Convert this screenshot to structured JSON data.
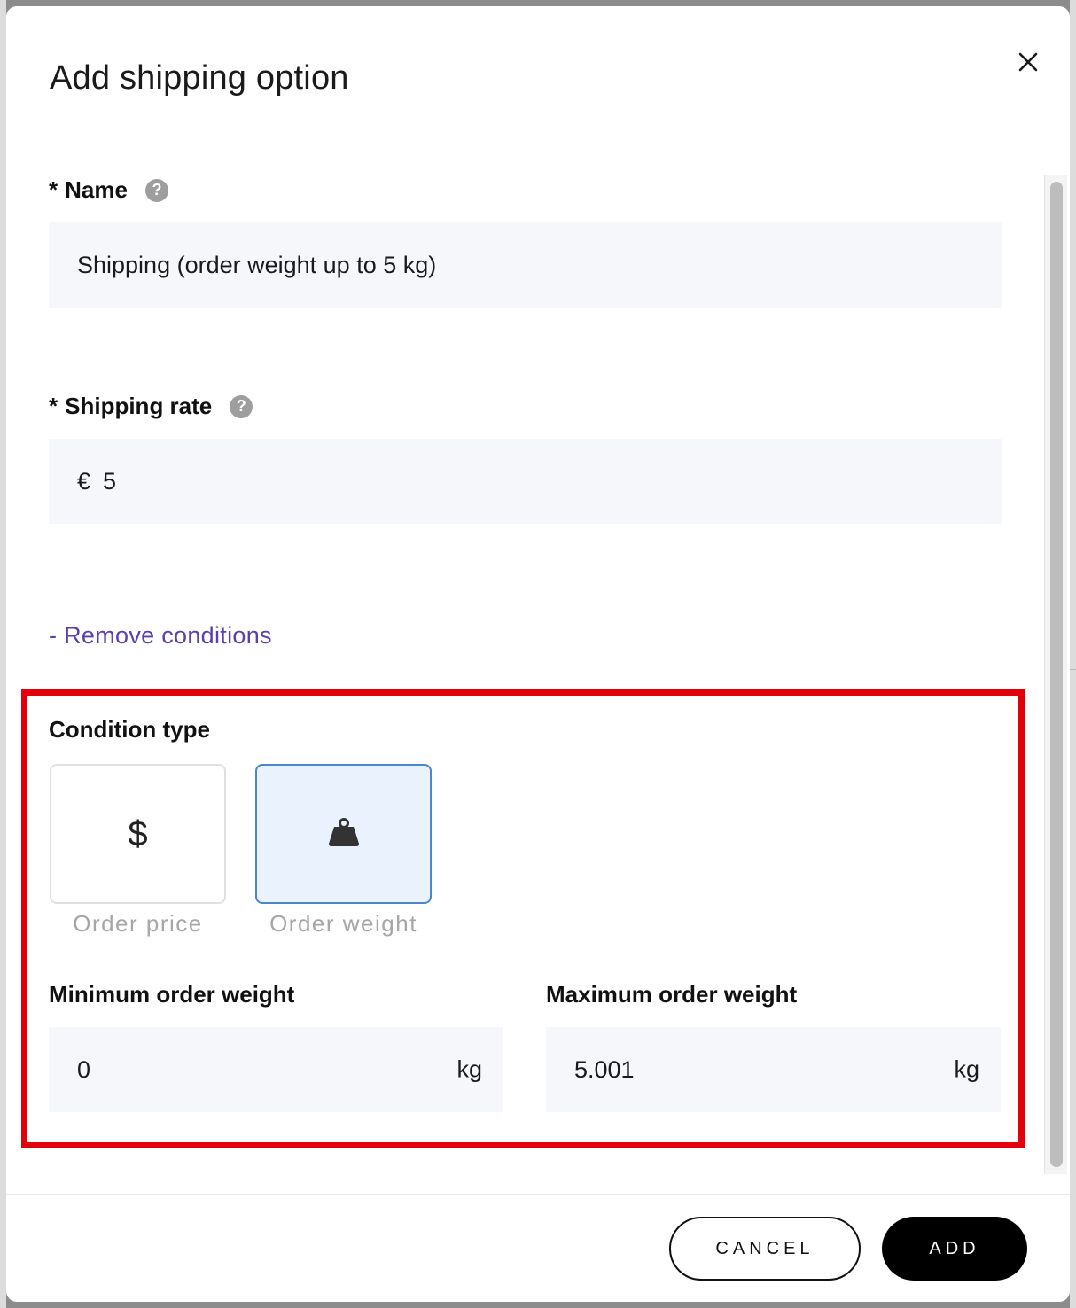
{
  "modal": {
    "title": "Add shipping option"
  },
  "name_field": {
    "required_marker": "*",
    "label": "Name",
    "help": "?",
    "value": "Shipping (order weight up to 5 kg)"
  },
  "rate_field": {
    "required_marker": "*",
    "label": "Shipping rate",
    "help": "?",
    "currency": "€",
    "value": "5"
  },
  "conditions": {
    "remove_link": "- Remove conditions",
    "section_title": "Condition type",
    "types": [
      {
        "label": "Order price",
        "icon": "dollar-icon",
        "selected": false
      },
      {
        "label": "Order weight",
        "icon": "weight-icon",
        "selected": true
      }
    ],
    "min": {
      "label": "Minimum order weight",
      "value": "0",
      "unit": "kg"
    },
    "max": {
      "label": "Maximum order weight",
      "value": "5.001",
      "unit": "kg"
    }
  },
  "footer": {
    "cancel_label": "CANCEL",
    "add_label": "ADD"
  },
  "colors": {
    "accent_link": "#5b3fae",
    "highlight": "#e3000b",
    "selected_card_border": "#4a86c8",
    "selected_card_bg": "#eaf2fd",
    "input_bg": "#f5f7fb"
  }
}
